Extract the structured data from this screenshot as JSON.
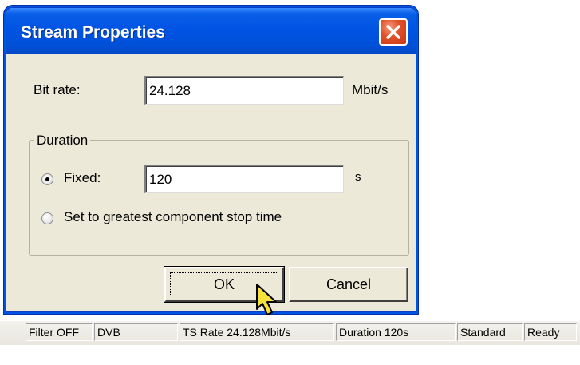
{
  "dialog": {
    "title": "Stream Properties",
    "bitrate": {
      "label": "Bit rate:",
      "value": "24.128",
      "unit": "Mbit/s"
    },
    "duration": {
      "group_label": "Duration",
      "fixed": {
        "label": "Fixed:",
        "selected": true,
        "value": "120",
        "unit": "s"
      },
      "greatest": {
        "label": "Set to greatest component stop time",
        "selected": false
      }
    },
    "ok_label": "OK",
    "cancel_label": "Cancel"
  },
  "statusbar": {
    "filter": "Filter OFF",
    "mode": "DVB",
    "ts_rate": "TS Rate 24.128Mbit/s",
    "duration": "Duration 120s",
    "standard": "Standard",
    "status": "Ready"
  },
  "colors": {
    "titlebar": "#0054e3",
    "close_button": "#e2522a",
    "dialog_face": "#ece9d8",
    "cursor": "#f7e23b"
  },
  "icons": {
    "close": "close-icon",
    "cursor": "arrow-cursor-icon"
  }
}
